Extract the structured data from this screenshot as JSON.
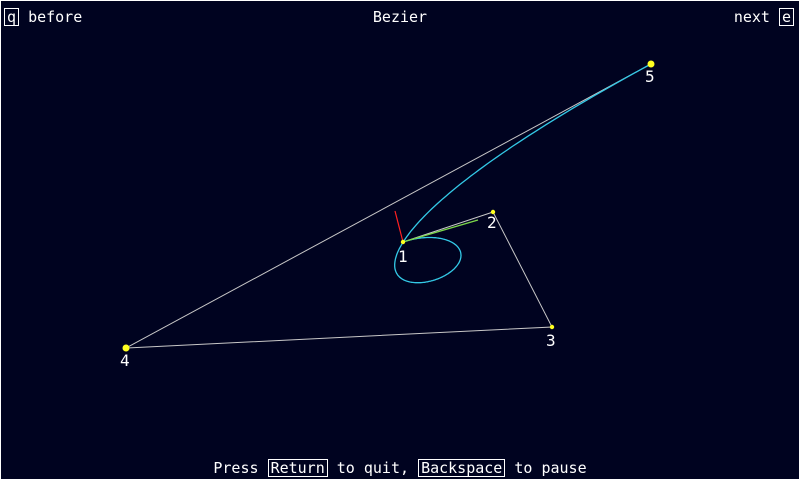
{
  "header": {
    "prev_key": "q",
    "prev_label": "before",
    "title": "Bezier",
    "next_label": "next",
    "next_key": "e"
  },
  "footer": {
    "press": "Press",
    "quit_key": "Return",
    "quit_text": "to quit,",
    "pause_key": "Backspace",
    "pause_text": "to pause"
  },
  "control_points": [
    {
      "label": "1"
    },
    {
      "label": "2"
    },
    {
      "label": "3"
    },
    {
      "label": "4"
    },
    {
      "label": "5"
    }
  ],
  "colors": {
    "background": "#000320",
    "polygon": "#c8c8c8",
    "curve": "#33c9e6",
    "tangent": "#7bd84a",
    "normal": "#ff2020",
    "point": "#ffff20",
    "text": "#ffffff"
  }
}
